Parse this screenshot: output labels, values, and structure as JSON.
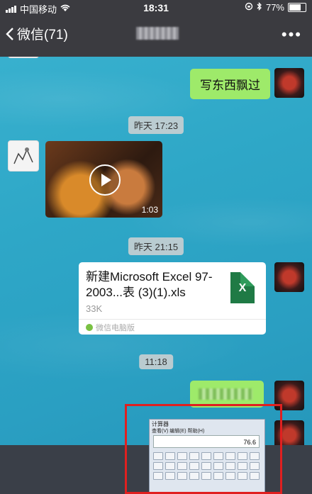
{
  "status_bar": {
    "carrier": "中国移动",
    "time": "18:31",
    "battery": "77%"
  },
  "nav": {
    "back_label": "微信(71)"
  },
  "messages": {
    "text_sent": "写东西飘过",
    "time_1": "昨天 17:23",
    "video_duration": "1:03",
    "time_2": "昨天 21:15",
    "file_name": "新建Microsoft Excel 97-2003...表 (3)(1).xls",
    "file_size": "33K",
    "file_source": "微信电脑版",
    "file_icon_letter": "X",
    "time_3": "11:18"
  },
  "calculator": {
    "title": "计算器",
    "menu": "查看(V)  编辑(E)  帮助(H)",
    "display": "76.6"
  },
  "colors": {
    "chat_bg": "#2ea7c7",
    "bubble_green": "#9eea6a",
    "nav_bg": "#3b3b40"
  }
}
